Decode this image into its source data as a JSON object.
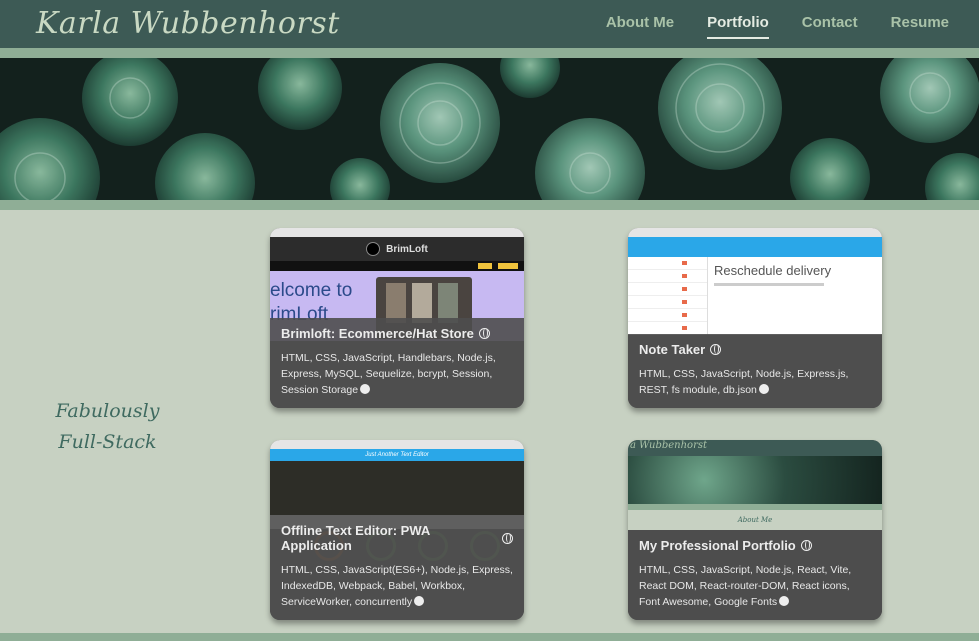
{
  "header": {
    "brand": "Karla Wubbenhorst",
    "nav": [
      "About Me",
      "Portfolio",
      "Contact",
      "Resume"
    ],
    "active_nav": "Portfolio"
  },
  "tagline": {
    "line1": "Fabulously",
    "line2": "Full-Stack"
  },
  "projects": [
    {
      "title": "Brimloft: Ecommerce/Hat Store",
      "tech": "HTML, CSS, JavaScript, Handlebars, Node.js, Express, MySQL, Sequelize, bcrypt, Session, Session Storage",
      "preview": {
        "site_name": "BrimLoft",
        "hero_text": "elcome to rimLoft"
      }
    },
    {
      "title": "Note Taker",
      "tech": "HTML, CSS, JavaScript, Node.js, Express.js, REST, fs module, db.json",
      "preview": {
        "heading": "Reschedule delivery"
      }
    },
    {
      "title": "Offline Text Editor: PWA Application",
      "tech": "HTML, CSS, JavaScript(ES6+), Node.js, Express, IndexedDB, Webpack, Babel, Workbox, ServiceWorker, concurrently",
      "preview": {
        "bar_title": "Just Another Text Editor"
      }
    },
    {
      "title": "My Professional Portfolio",
      "tech": "HTML, CSS, JavaScript, Node.js, React, Vite, React DOM, React-router-DOM, React icons, Font Awesome, Google Fonts",
      "preview": {
        "brand": "a Wubbenhorst",
        "section": "About Me"
      }
    }
  ],
  "colors": {
    "page_bg": "#c7d1c2",
    "header_bg": "#3d5a55",
    "accent_band": "#8fae96",
    "tagline": "#3f6a60"
  }
}
